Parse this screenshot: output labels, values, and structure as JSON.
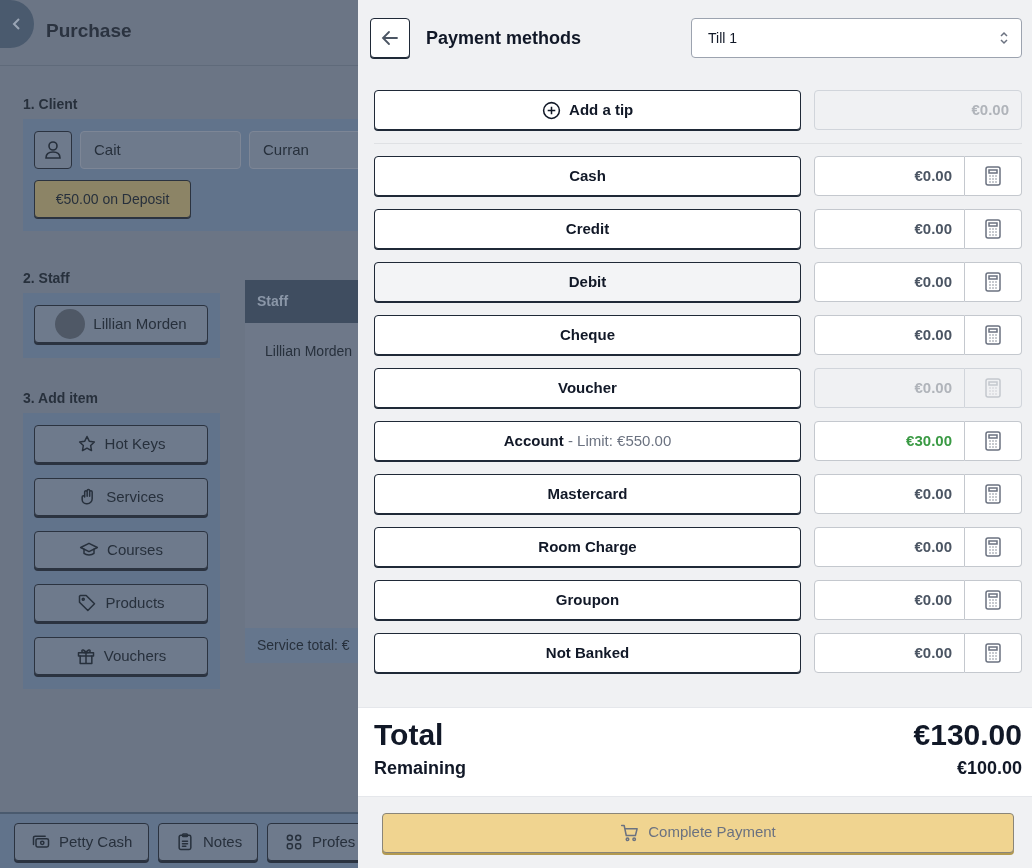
{
  "page": {
    "title": "Purchase"
  },
  "client": {
    "heading": "1. Client",
    "first_name": "Cait",
    "last_name": "Curran",
    "deposit": "€50.00 on Deposit"
  },
  "staff": {
    "heading": "2. Staff",
    "member": "Lillian Morden"
  },
  "staff_table": {
    "header": "Staff",
    "rows": [
      "Lillian Morden"
    ],
    "footer": "Service total: €"
  },
  "add_item": {
    "heading": "3. Add item",
    "buttons": [
      {
        "label": "Hot Keys",
        "kind": "star"
      },
      {
        "label": "Services",
        "kind": "hand"
      },
      {
        "label": "Courses",
        "kind": "cap"
      },
      {
        "label": "Products",
        "kind": "tag"
      },
      {
        "label": "Vouchers",
        "kind": "gift"
      }
    ]
  },
  "bottom_bar": [
    {
      "label": "Petty Cash",
      "kind": "cash"
    },
    {
      "label": "Notes",
      "kind": "clipboard"
    },
    {
      "label": "Profes",
      "kind": "grid"
    }
  ],
  "payment_panel": {
    "title": "Payment methods",
    "till": "Till 1",
    "tip": {
      "label": "Add a tip",
      "amount": "€0.00",
      "disabled": true
    },
    "methods": [
      {
        "label": "Cash",
        "amount": "€0.00",
        "disabled": false,
        "paid": false,
        "hovered": false
      },
      {
        "label": "Credit",
        "amount": "€0.00",
        "disabled": false,
        "paid": false,
        "hovered": false
      },
      {
        "label": "Debit",
        "amount": "€0.00",
        "disabled": false,
        "paid": false,
        "hovered": true
      },
      {
        "label": "Cheque",
        "amount": "€0.00",
        "disabled": false,
        "paid": false,
        "hovered": false
      },
      {
        "label": "Voucher",
        "amount": "€0.00",
        "disabled": true,
        "paid": false,
        "hovered": false
      },
      {
        "label": "Account",
        "note": "- Limit: €550.00",
        "amount": "€30.00",
        "disabled": false,
        "paid": true,
        "hovered": false
      },
      {
        "label": "Mastercard",
        "amount": "€0.00",
        "disabled": false,
        "paid": false,
        "hovered": false
      },
      {
        "label": "Room Charge",
        "amount": "€0.00",
        "disabled": false,
        "paid": false,
        "hovered": false
      },
      {
        "label": "Groupon",
        "amount": "€0.00",
        "disabled": false,
        "paid": false,
        "hovered": false
      },
      {
        "label": "Not Banked",
        "amount": "€0.00",
        "disabled": false,
        "paid": false,
        "hovered": false
      }
    ],
    "total_label": "Total",
    "total": "€130.00",
    "remaining_label": "Remaining",
    "remaining": "€100.00",
    "complete": {
      "label": "Complete Payment",
      "disabled": true
    }
  }
}
